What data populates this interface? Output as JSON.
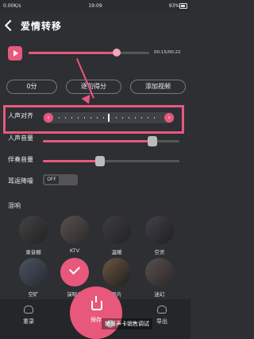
{
  "status": {
    "carrier": "0.00K/s",
    "time": "19:09",
    "battery": "93%"
  },
  "header": {
    "title": "爱情转移"
  },
  "player": {
    "progress": 0.73,
    "time_text": "00:15/00:22"
  },
  "tabs": [
    {
      "label": "0分"
    },
    {
      "label": "逐句得分"
    },
    {
      "label": "添加视频"
    }
  ],
  "controls": {
    "vocal_alignment": "人声对齐",
    "vocal_volume": "人声音量",
    "accompaniment_volume": "伴奏音量",
    "noise_reduction": "耳返降噪",
    "toggle_off": "OFF",
    "vocal_volume_level": 0.8,
    "accompaniment_volume_level": 0.42
  },
  "effects": {
    "section_title": "混响",
    "items": [
      {
        "label": "录音棚"
      },
      {
        "label": "KTV"
      },
      {
        "label": "温暖"
      },
      {
        "label": "空灵"
      },
      {
        "label": "空旷"
      },
      {
        "label": "演唱会"
      },
      {
        "label": "唱片"
      },
      {
        "label": "迷幻"
      }
    ]
  },
  "bottom": {
    "left": "重录",
    "center": "保存",
    "right": "导出"
  },
  "watermark": "猪哥声卡销售调试"
}
